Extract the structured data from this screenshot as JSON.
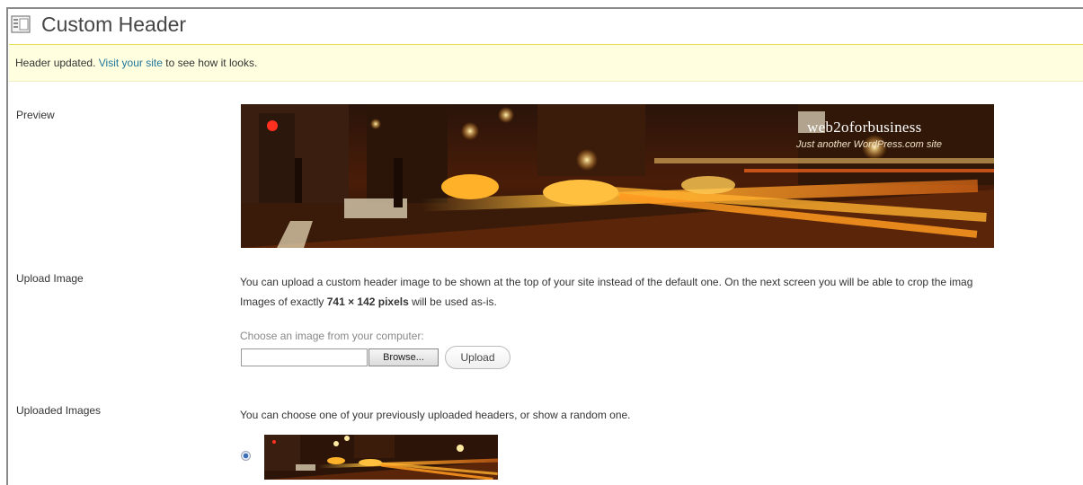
{
  "page": {
    "title": "Custom Header",
    "icon": "appearance-header-icon"
  },
  "notice": {
    "prefix": "Header updated.",
    "link_text": "Visit your site",
    "suffix": "to see how it looks."
  },
  "preview": {
    "label": "Preview",
    "site_title": "web2oforbusiness",
    "site_tagline": "Just another WordPress.com site"
  },
  "upload_image": {
    "label": "Upload Image",
    "description_line1": "You can upload a custom header image to be shown at the top of your site instead of the default one. On the next screen you will be able to crop the imag",
    "description_line2_prefix": "Images of exactly",
    "dimensions": "741 × 142 pixels",
    "description_line2_suffix": "will be used as-is.",
    "choose_label": "Choose an image from your computer:",
    "file_value": "",
    "browse_label": "Browse...",
    "upload_label": "Upload"
  },
  "uploaded_images": {
    "label": "Uploaded Images",
    "description": "You can choose one of your previously uploaded headers, or show a random one.",
    "selected": true
  }
}
